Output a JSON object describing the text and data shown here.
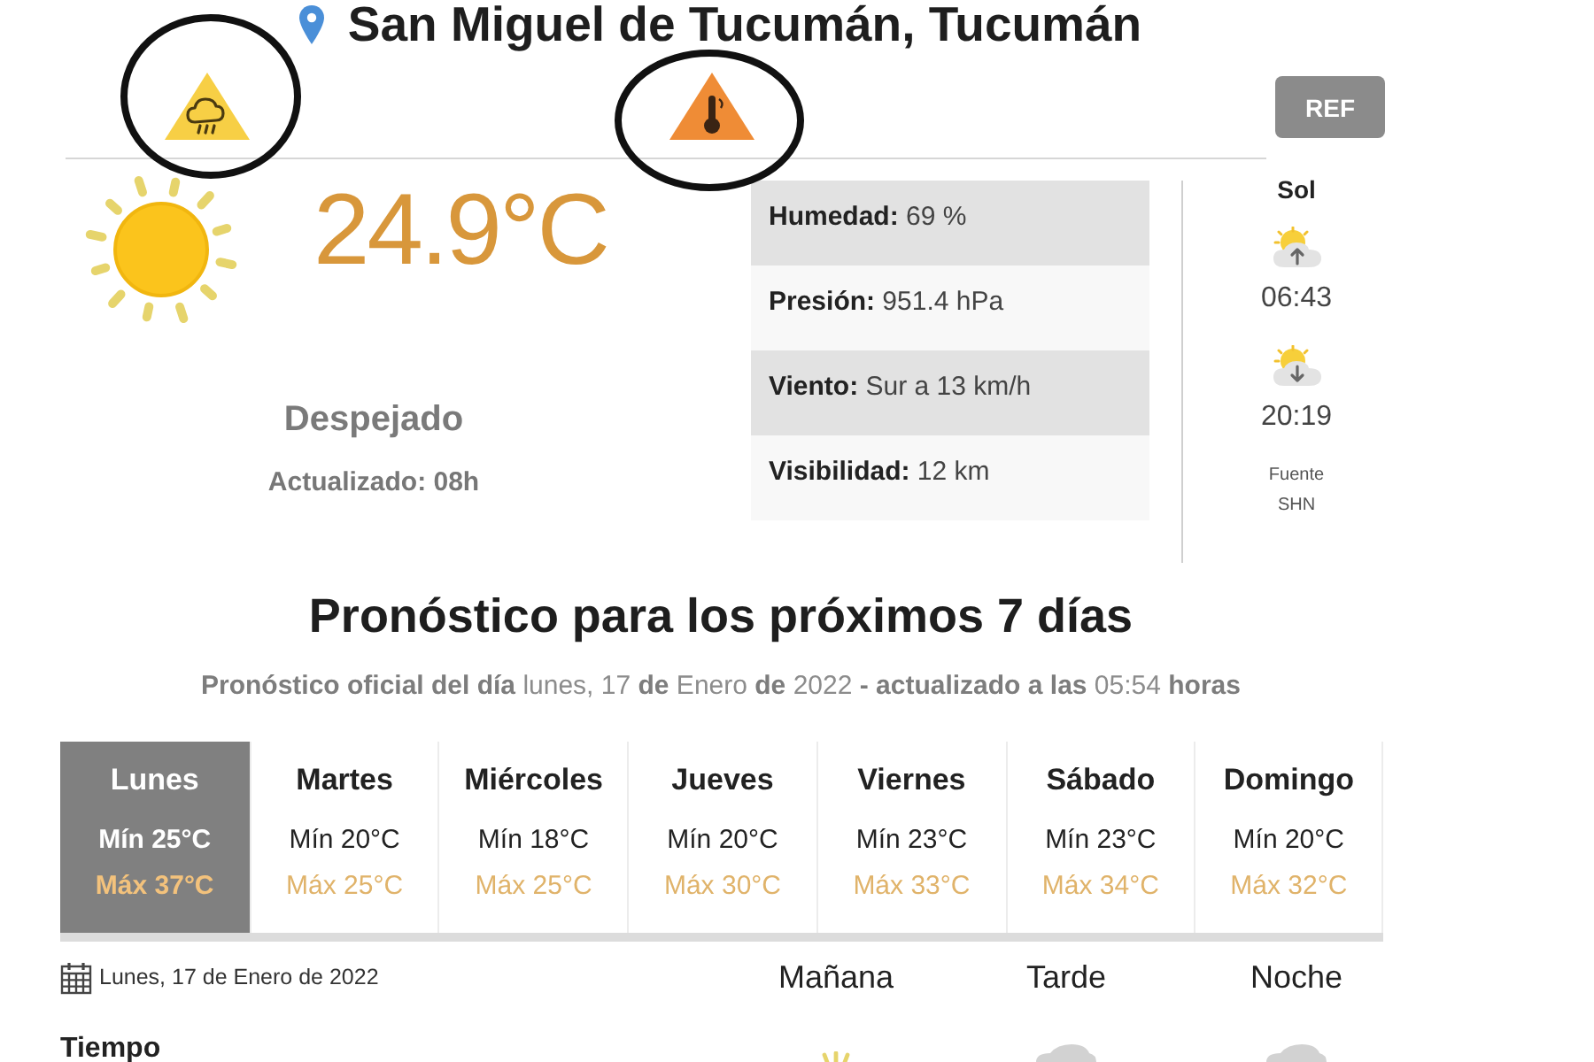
{
  "location": {
    "title": "San Miguel de Tucumán, Tucumán"
  },
  "alerts": [
    {
      "kind": "storm",
      "color": "#f7cf45",
      "circled": true
    },
    {
      "kind": "heat",
      "color": "#ef8c36",
      "circled": true
    }
  ],
  "ref_button": "REF",
  "current": {
    "temperature": "24.9°C",
    "condition": "Despejado",
    "updated": "Actualizado: 08h"
  },
  "details": [
    "**Humedad:** 69 %",
    "**Presión:** 951.4 hPa",
    "**Viento:** Sur a 13 km/h",
    "**Visibilidad:** 12 km"
  ],
  "sun": {
    "title": "Sol",
    "sunrise": "06:43",
    "sunset": "20:19",
    "source_label": "Fuente",
    "source_name": "SHN"
  },
  "forecast": {
    "title": "Pronóstico para los próximos 7 días",
    "subtitle": "**Pronóstico oficial del día** lunes, 17 **de** Enero **de** 2022 **- actualizado a las** 05:54 **horas**",
    "days": [
      {
        "name": "Lunes",
        "min": "Mín 25°C",
        "max": "Máx 37°C",
        "selected": true
      },
      {
        "name": "Martes",
        "min": "Mín 20°C",
        "max": "Máx 25°C",
        "selected": false
      },
      {
        "name": "Miércoles",
        "min": "Mín 18°C",
        "max": "Máx 25°C",
        "selected": false
      },
      {
        "name": "Jueves",
        "min": "Mín 20°C",
        "max": "Máx 30°C",
        "selected": false
      },
      {
        "name": "Viernes",
        "min": "Mín 23°C",
        "max": "Máx 33°C",
        "selected": false
      },
      {
        "name": "Sábado",
        "min": "Mín 23°C",
        "max": "Máx 34°C",
        "selected": false
      },
      {
        "name": "Domingo",
        "min": "Mín 20°C",
        "max": "Máx 32°C",
        "selected": false
      }
    ]
  },
  "day_detail": {
    "date": "Lunes, 17 de Enero de 2022",
    "periods": [
      {
        "label": "Mañana",
        "kind": "clear"
      },
      {
        "label": "Tarde",
        "kind": "cloudy"
      },
      {
        "label": "Noche",
        "kind": "cloudy"
      }
    ],
    "row_label": "Tiempo"
  }
}
